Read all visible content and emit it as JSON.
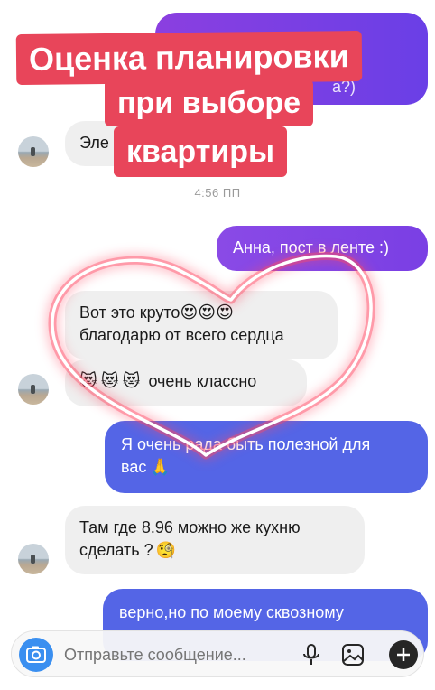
{
  "overlay_title": {
    "line1": "Оценка планировки",
    "line2": "при выборе",
    "line3": "квартиры"
  },
  "messages": {
    "top_outgoing_fragment": "а?)",
    "incoming_1_fragment": "Эле",
    "timestamp": "4:56 ПП",
    "outgoing_1": "Анна, пост в ленте :)",
    "incoming_2_line1": "Вот это круто",
    "incoming_2_emoji": "😍😍😍",
    "incoming_2_line2": "благодарю от всего сердца",
    "incoming_3_emoji": "😻😻😻",
    "incoming_3_text": "очень классно",
    "outgoing_2_line1": "Я очень рада быть полезной для",
    "outgoing_2_line2": "вас",
    "outgoing_2_emoji": "🙏",
    "incoming_4_line1": "Там где 8.96 можно же кухню",
    "incoming_4_line2": "сделать ?",
    "incoming_4_emoji": "🧐",
    "outgoing_3": "верно,но по моему сквозному"
  },
  "composer": {
    "placeholder": "Отправьте сообщение..."
  },
  "icons": [
    "camera-icon",
    "microphone-icon",
    "gallery-icon",
    "plus-icon"
  ],
  "colors": {
    "title_bg": "#e8455a",
    "bubble_purple": "#7b3fe4",
    "bubble_blue": "#5566e6",
    "incoming_bg": "#efefef",
    "camera_blue": "#3a8ff0",
    "heart_glow": "#ff3b5c"
  }
}
